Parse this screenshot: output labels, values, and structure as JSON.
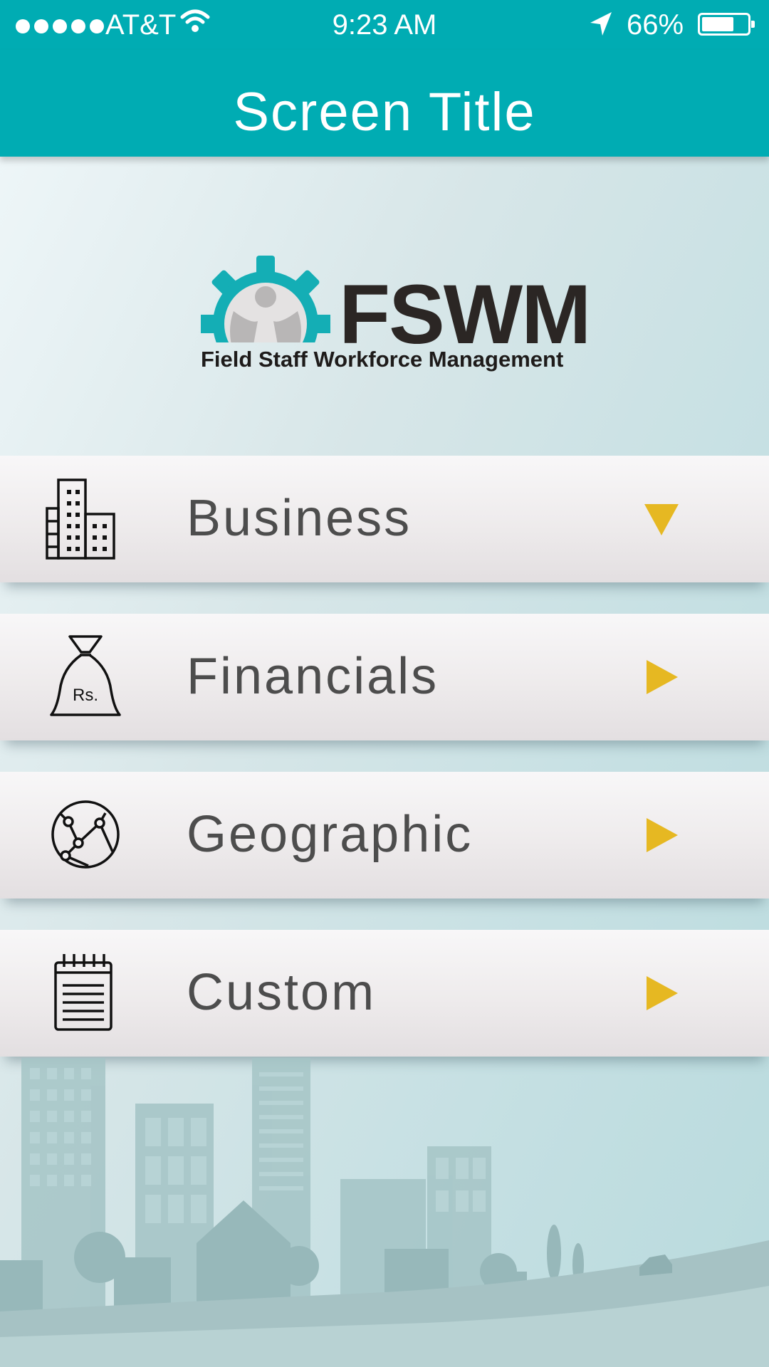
{
  "status_bar": {
    "carrier": "AT&T",
    "time": "9:23 AM",
    "battery_percent": "66%",
    "battery_level": 0.66,
    "icons": [
      "signal-dots-icon",
      "wifi-icon",
      "location-arrow-icon",
      "battery-icon"
    ]
  },
  "nav_bar": {
    "title": "Screen Title",
    "color": "#00acb3"
  },
  "logo": {
    "wordmark": "FSWM",
    "tagline": "Field Staff Workforce Management",
    "colors": {
      "gear": "#14aeb5",
      "figure": "#b8b6b6",
      "text": "#2b2624"
    }
  },
  "menu": {
    "arrow_color": "#e6b822",
    "items": [
      {
        "label": "Business",
        "icon": "building-icon",
        "arrow": "down"
      },
      {
        "label": "Financials",
        "icon": "money-bag-icon",
        "arrow": "right"
      },
      {
        "label": "Geographic",
        "icon": "globe-network-icon",
        "arrow": "right"
      },
      {
        "label": "Custom",
        "icon": "notepad-icon",
        "arrow": "right"
      }
    ]
  }
}
